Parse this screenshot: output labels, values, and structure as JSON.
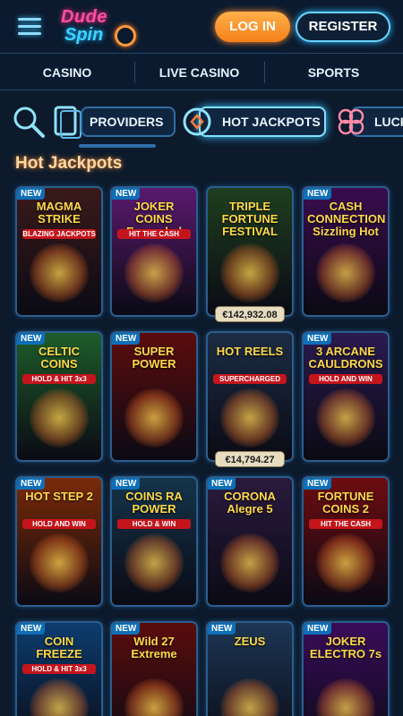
{
  "header": {
    "logo_line1": "Dude",
    "logo_line2": "Spin",
    "login_label": "LOG IN",
    "register_label": "REGISTER"
  },
  "nav": {
    "tabs": [
      {
        "label": "CASINO"
      },
      {
        "label": "LIVE CASINO"
      },
      {
        "label": "SPORTS"
      }
    ]
  },
  "categories": [
    {
      "label": "PROVIDERS",
      "icon": "search-icon"
    },
    {
      "label": "HOT JACKPOTS",
      "icon": "jackpot-icon",
      "active": true
    },
    {
      "label": "LUCK",
      "icon": "clover-icon"
    }
  ],
  "section": {
    "title": "Hot Jackpots"
  },
  "games": [
    {
      "title": "MAGMA STRIKE",
      "badge": "NEW",
      "subtitle": "BLAZING JACKPOTS",
      "bg": "#3a1a1a"
    },
    {
      "title": "JOKER COINS Expanded",
      "badge": "NEW",
      "subtitle": "HIT THE CASH",
      "bg": "#5a1a6e"
    },
    {
      "title": "TRIPLE FORTUNE FESTIVAL",
      "badge": "",
      "subtitle": "",
      "bg": "#1f3e20",
      "jackpot": "€142,932.08"
    },
    {
      "title": "CASH CONNECTION Sizzling Hot",
      "badge": "NEW",
      "subtitle": "",
      "bg": "#3a0c4e"
    },
    {
      "title": "CELTIC COINS",
      "badge": "NEW",
      "subtitle": "HOLD & HIT 3x3",
      "bg": "#1e5c2a"
    },
    {
      "title": "SUPER POWER",
      "badge": "NEW",
      "subtitle": "",
      "bg": "#5c0c0c"
    },
    {
      "title": "HOT REELS",
      "badge": "",
      "subtitle": "SUPERCHARGED",
      "bg": "#1c2c44",
      "jackpot": "€14,794.27"
    },
    {
      "title": "3 ARCANE CAULDRONS",
      "badge": "NEW",
      "subtitle": "HOLD AND WIN",
      "bg": "#2a1a4e"
    },
    {
      "title": "HOT STEP 2",
      "badge": "NEW",
      "subtitle": "HOLD AND WIN",
      "bg": "#7a2a08"
    },
    {
      "title": "COINS RA POWER",
      "badge": "NEW",
      "subtitle": "HOLD & WIN",
      "bg": "#14344a"
    },
    {
      "title": "CORONA Alegre 5",
      "badge": "NEW",
      "subtitle": "",
      "bg": "#2a1a3e"
    },
    {
      "title": "FORTUNE COINS 2",
      "badge": "NEW",
      "subtitle": "HIT THE CASH",
      "bg": "#6e0c10"
    },
    {
      "title": "COIN FREEZE",
      "badge": "NEW",
      "subtitle": "HOLD & HIT 3x3",
      "bg": "#0c3c6e"
    },
    {
      "title": "Wild 27 Extreme",
      "badge": "NEW",
      "subtitle": "",
      "bg": "#5a0c0c"
    },
    {
      "title": "ZEUS",
      "badge": "NEW",
      "subtitle": "",
      "bg": "#1c3654"
    },
    {
      "title": "JOKER ELECTRO 7s",
      "badge": "NEW",
      "subtitle": "",
      "bg": "#3a0c5a"
    }
  ]
}
